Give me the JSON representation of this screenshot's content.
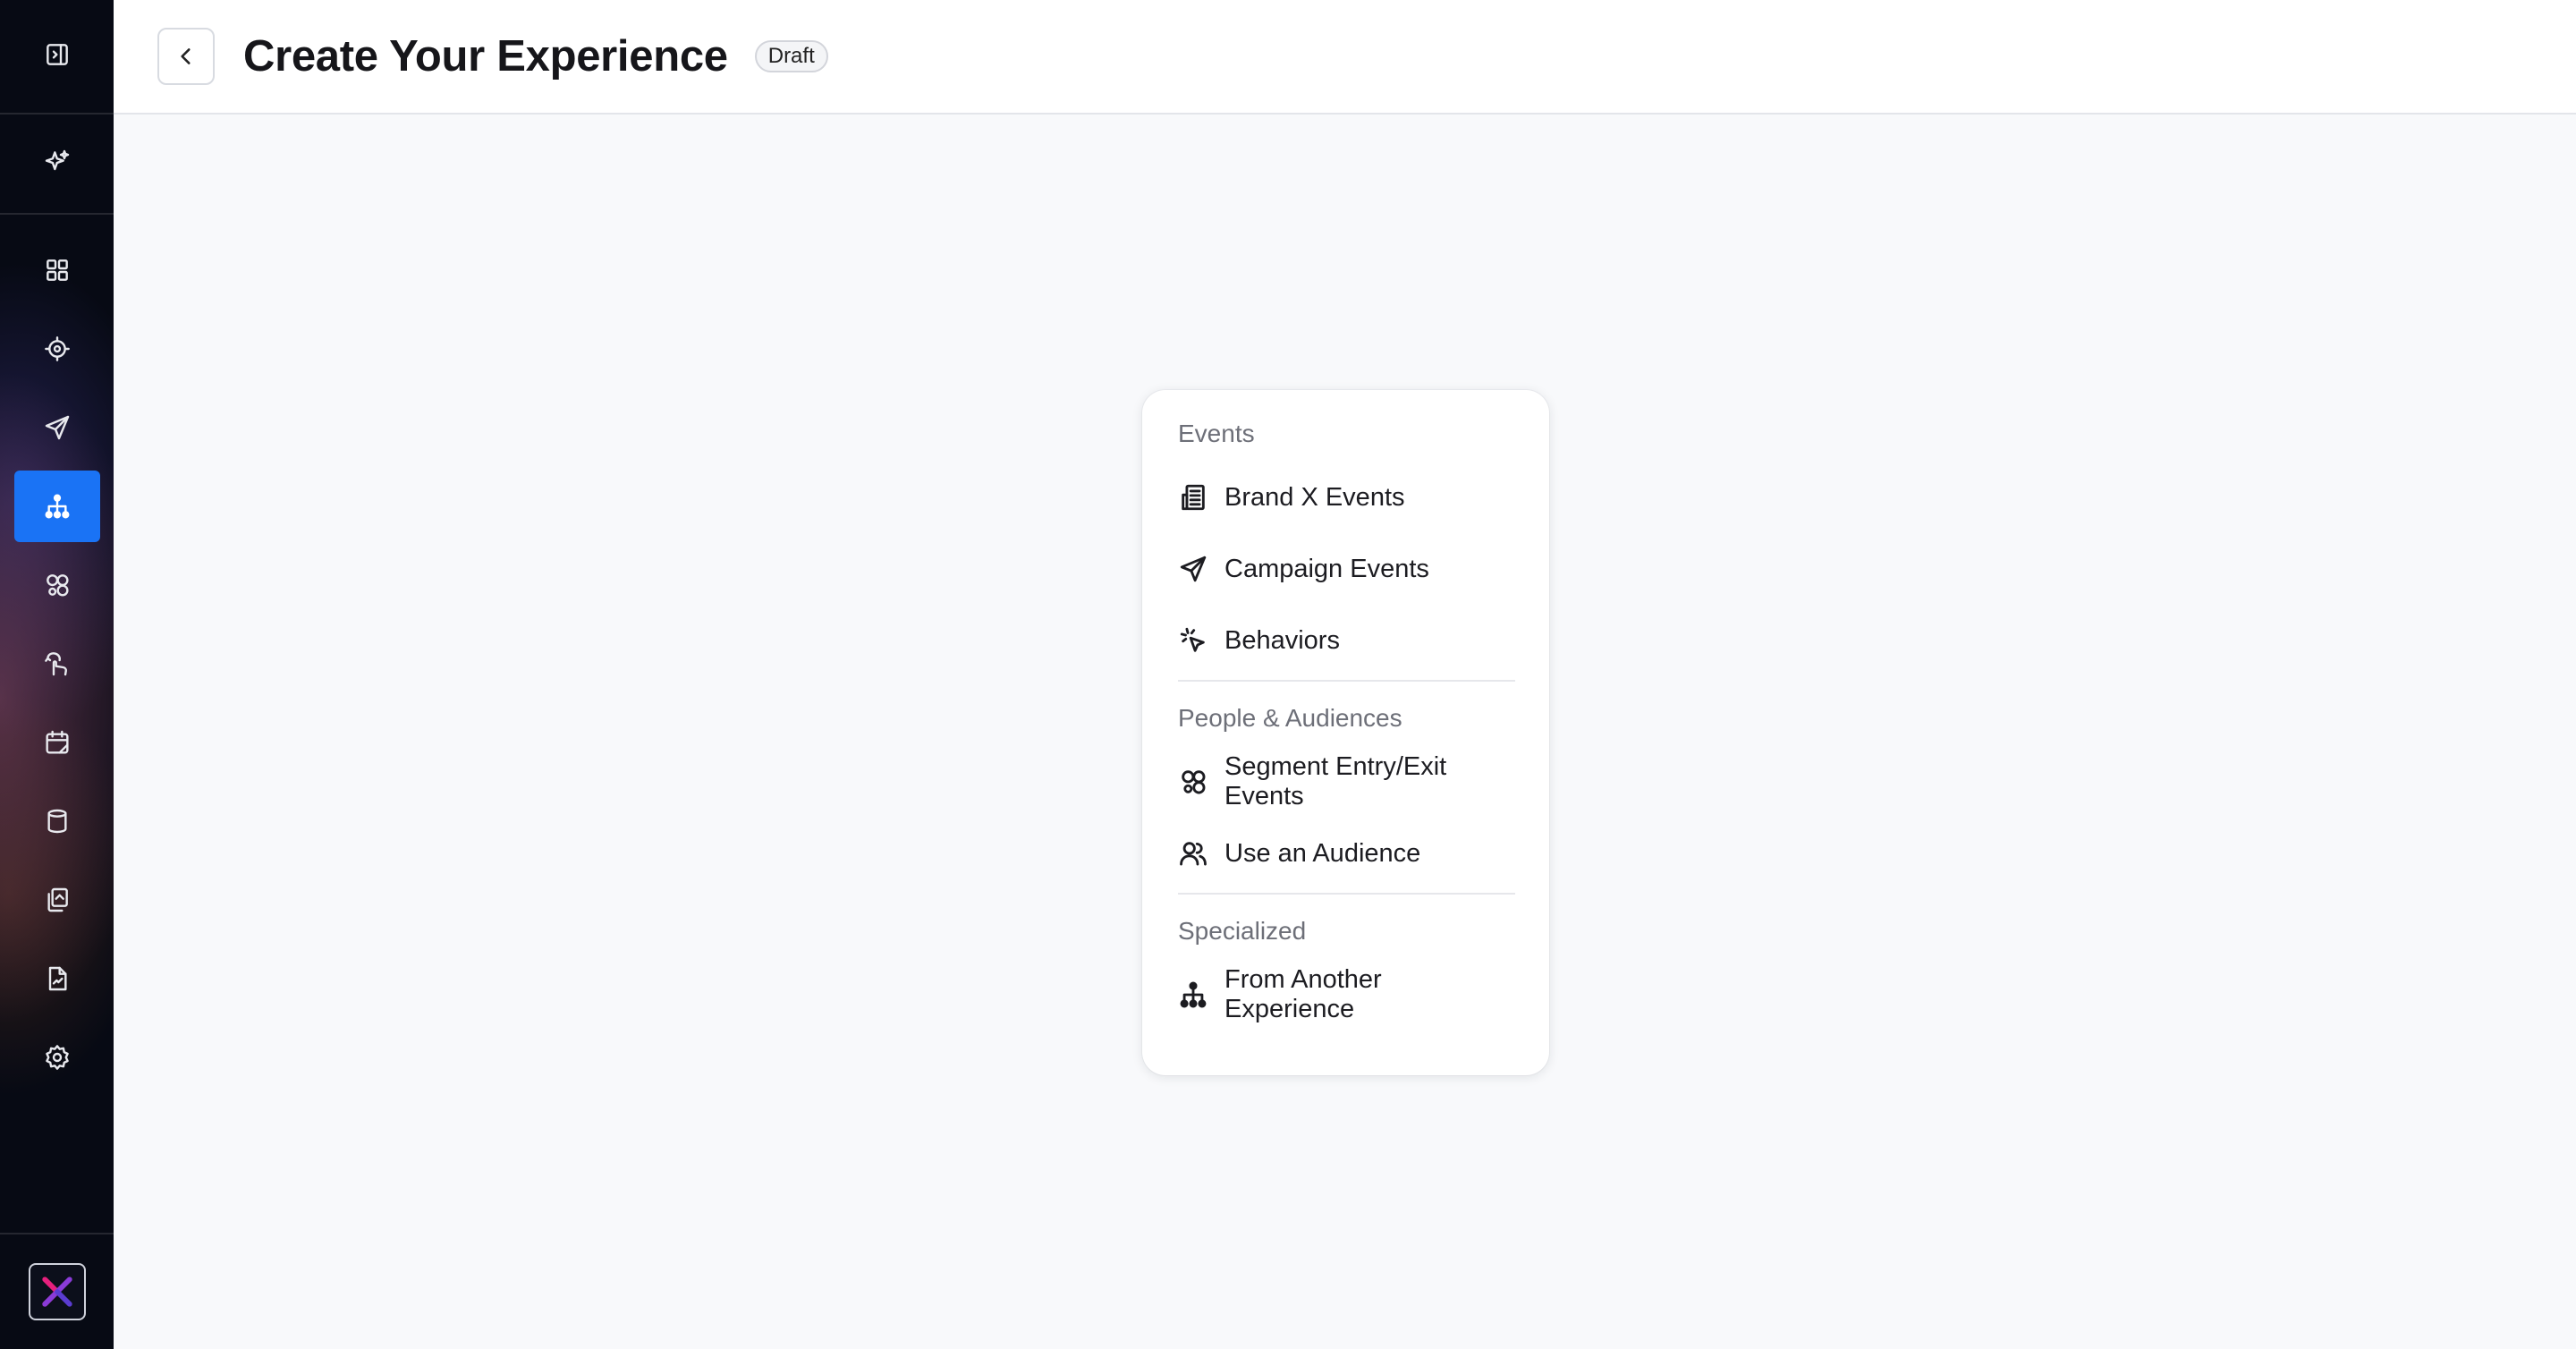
{
  "header": {
    "title": "Create Your Experience",
    "status_badge": "Draft"
  },
  "sidebar": {
    "items": [
      {
        "icon": "dashboard-icon"
      },
      {
        "icon": "target-icon"
      },
      {
        "icon": "send-icon"
      },
      {
        "icon": "hierarchy-icon",
        "active": true
      },
      {
        "icon": "segments-icon"
      },
      {
        "icon": "hand-pointer-icon"
      },
      {
        "icon": "calendar-icon"
      },
      {
        "icon": "database-icon"
      },
      {
        "icon": "documents-icon"
      },
      {
        "icon": "report-icon"
      },
      {
        "icon": "gear-icon"
      }
    ],
    "active_color": "#1a73f5"
  },
  "menu": {
    "sections": [
      {
        "label": "Events",
        "items": [
          {
            "label": "Brand X Events",
            "icon": "building-icon"
          },
          {
            "label": "Campaign Events",
            "icon": "send-icon"
          },
          {
            "label": "Behaviors",
            "icon": "cursor-click-icon"
          }
        ]
      },
      {
        "label": "People & Audiences",
        "items": [
          {
            "label": "Segment Entry/Exit Events",
            "icon": "segments-icon"
          },
          {
            "label": "Use an Audience",
            "icon": "users-icon"
          }
        ]
      },
      {
        "label": "Specialized",
        "items": [
          {
            "label": "From Another Experience",
            "icon": "hierarchy-icon"
          }
        ]
      }
    ]
  }
}
